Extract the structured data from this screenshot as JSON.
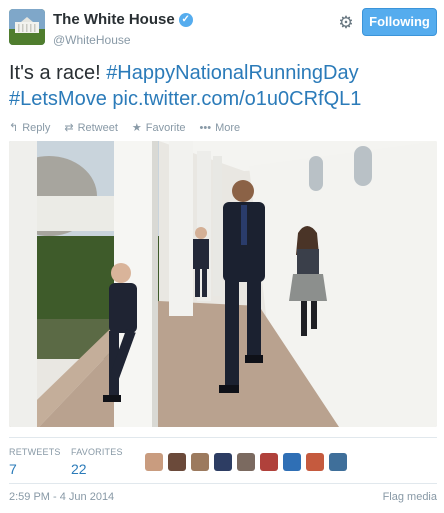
{
  "account": {
    "display_name": "The White House",
    "handle": "@WhiteHouse",
    "verified_icon": "verified-badge-icon"
  },
  "follow_button": {
    "label": "Following"
  },
  "tweet": {
    "text_plain": "It's a race! ",
    "hashtag1": "#HappyNationalRunningDay",
    "hashtag2": "#LetsMove",
    "link": "pic.twitter.com/o1u0CRfQL1"
  },
  "actions": {
    "reply": "Reply",
    "retweet": "Retweet",
    "favorite": "Favorite",
    "more": "More"
  },
  "stats": {
    "retweets_label": "RETWEETS",
    "retweets_value": "7",
    "favorites_label": "FAVORITES",
    "favorites_value": "22"
  },
  "footer": {
    "timestamp": "2:59 PM - 4 Jun 2014",
    "flag_label": "Flag media"
  },
  "colors": {
    "accent": "#55acee",
    "link": "#2b7bb9",
    "muted": "#8899a6"
  }
}
